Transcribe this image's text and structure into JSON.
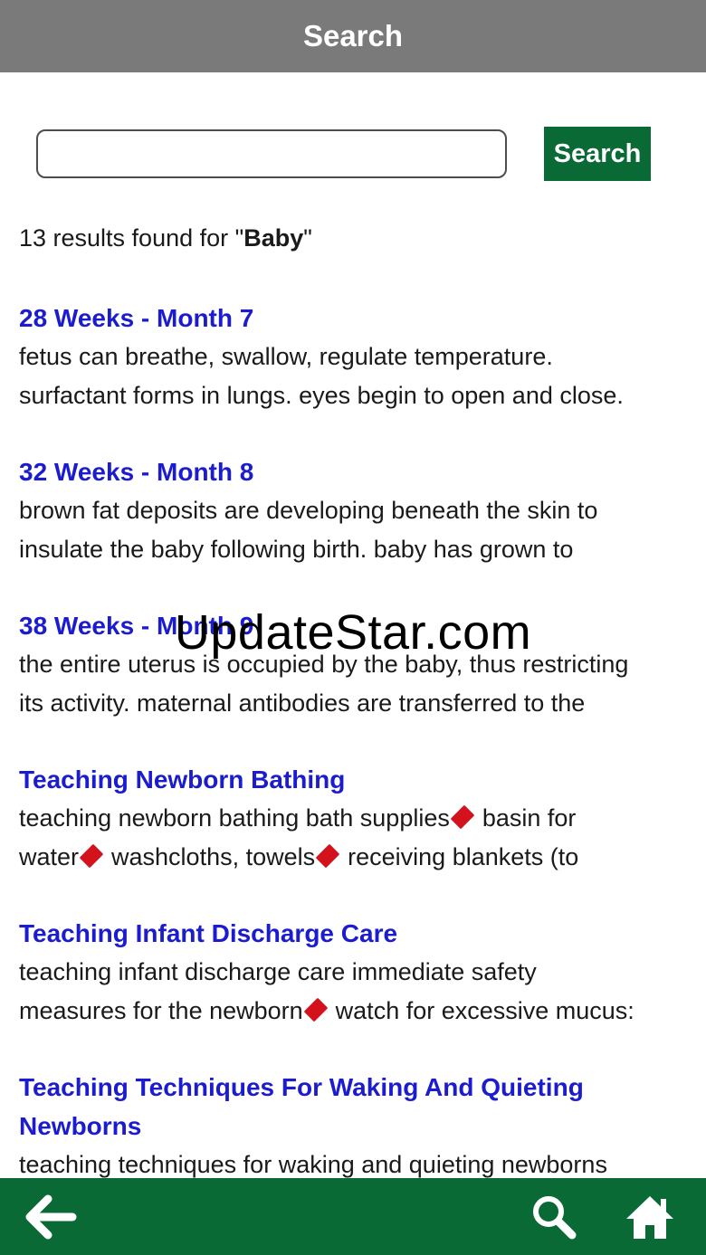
{
  "header": {
    "title": "Search"
  },
  "search": {
    "value": "",
    "placeholder": "",
    "button_label": "Search"
  },
  "summary": {
    "prefix": "13 results found for \"",
    "term": "Baby",
    "suffix": "\""
  },
  "results": [
    {
      "title": "28 Weeks - Month 7",
      "lines": [
        [
          "fetus can breathe, swallow, regulate temperature."
        ],
        [
          "surfactant forms in lungs. eyes begin to open and close."
        ]
      ]
    },
    {
      "title": "32 Weeks - Month 8",
      "lines": [
        [
          "brown fat deposits are developing beneath the skin to"
        ],
        [
          "insulate the baby following birth. baby has grown to"
        ]
      ]
    },
    {
      "title": "38 Weeks - Month 9",
      "lines": [
        [
          "the entire uterus is occupied by the baby, thus restricting"
        ],
        [
          "its activity. maternal antibodies are transferred to the"
        ]
      ]
    },
    {
      "title": "Teaching Newborn Bathing",
      "lines": [
        [
          "teaching newborn bathing bath supplies",
          "basin for"
        ],
        [
          "water",
          "washcloths, towels",
          "receiving blankets (to"
        ]
      ]
    },
    {
      "title": "Teaching Infant Discharge Care",
      "lines": [
        [
          "teaching infant discharge care immediate safety"
        ],
        [
          "measures for the newborn",
          "watch for excessive mucus:"
        ]
      ]
    },
    {
      "title": "Teaching Techniques For Waking And Quieting Newborns",
      "lines": [
        [
          "teaching techniques for waking and quieting newborns"
        ]
      ]
    }
  ],
  "watermark": "UpdateStar.com",
  "nav": {
    "back": "arrow-left-icon",
    "search": "magnifier-icon",
    "home": "house-icon"
  },
  "colors": {
    "header_bg": "#7a7a7a",
    "brand_green": "#0a6a35",
    "link_blue": "#1b1ccf",
    "bullet_red": "#d4121c"
  }
}
